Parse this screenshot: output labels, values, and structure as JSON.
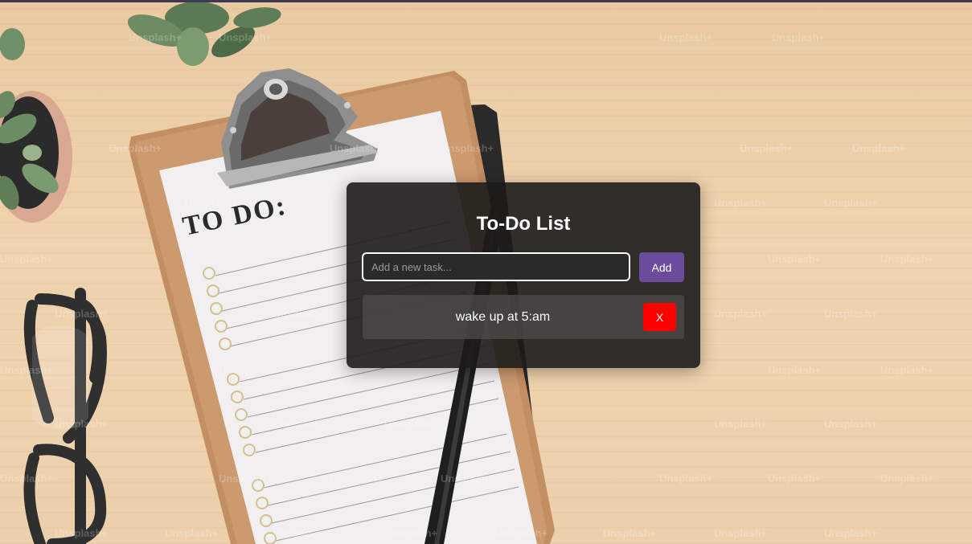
{
  "background": {
    "clipboard_heading": "TO DO:",
    "watermark_text": "Unsplash+"
  },
  "todo_card": {
    "title": "To-Do List",
    "input": {
      "placeholder": "Add a new task...",
      "value": ""
    },
    "add_label": "Add",
    "tasks": [
      {
        "text": "wake up at 5:am",
        "delete_label": "X"
      }
    ]
  },
  "colors": {
    "add_button": "#6a4b9c",
    "delete_button": "#ff0000",
    "card_background": "#1c1b1a"
  }
}
